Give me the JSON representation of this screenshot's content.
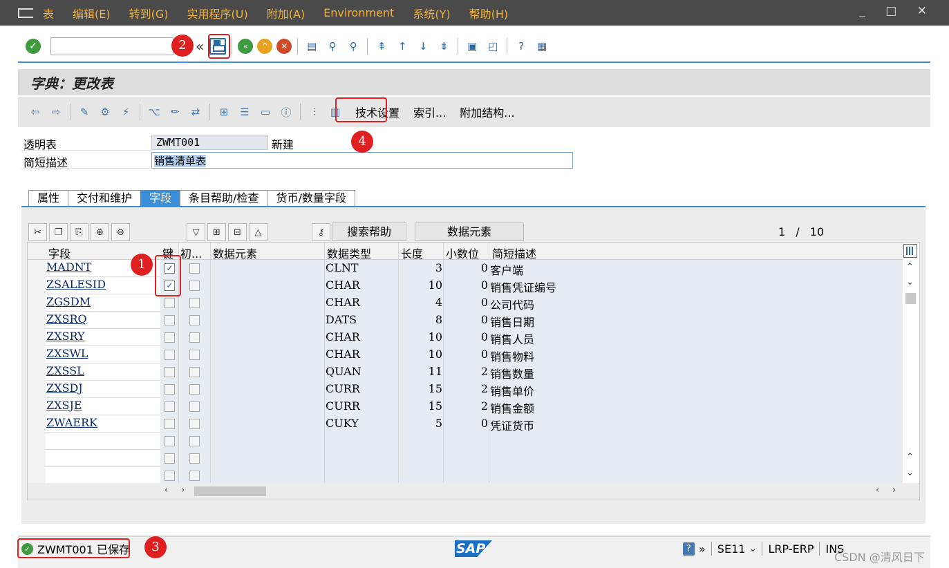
{
  "menubar": {
    "items": [
      "表",
      "编辑(E)",
      "转到(G)",
      "实用程序(U)",
      "附加(A)",
      "Environment",
      "系统(Y)",
      "帮助(H)"
    ],
    "window_controls": "_ □ ✕"
  },
  "toolbar": {
    "command_value": "",
    "collapse_glyph": "«"
  },
  "title": "字典：更改表",
  "app_toolbar": {
    "tech_settings": "技术设置",
    "indexes": "索引...",
    "append_structures": "附加结构..."
  },
  "header": {
    "table_label": "透明表",
    "table_name": "ZWMT001",
    "table_status": "新建",
    "desc_label": "简短描述",
    "desc_value": "销售清单表"
  },
  "tabs": [
    {
      "label": "属性",
      "active": false
    },
    {
      "label": "交付和维护",
      "active": false
    },
    {
      "label": "字段",
      "active": true
    },
    {
      "label": "条目帮助/检查",
      "active": false
    },
    {
      "label": "货币/数量字段",
      "active": false
    }
  ],
  "grid_toolbar": {
    "search_help": "搜索帮助",
    "data_element": "数据元素",
    "page_current": "1",
    "page_sep": "/",
    "page_total": "10"
  },
  "columns": {
    "field": "字段",
    "key": "键",
    "initial": "初...",
    "data_element": "数据元素",
    "data_type": "数据类型",
    "length": "长度",
    "decimals": "小数位",
    "short_desc": "简短描述"
  },
  "rows": [
    {
      "field": "MADNT",
      "key": true,
      "initial": false,
      "dtel": "",
      "type": "CLNT",
      "len": "3",
      "dec": "0",
      "desc": "客户端"
    },
    {
      "field": "ZSALESID",
      "key": true,
      "initial": false,
      "dtel": "",
      "type": "CHAR",
      "len": "10",
      "dec": "0",
      "desc": "销售凭证编号"
    },
    {
      "field": "ZGSDM",
      "key": false,
      "initial": false,
      "dtel": "",
      "type": "CHAR",
      "len": "4",
      "dec": "0",
      "desc": "公司代码"
    },
    {
      "field": "ZXSRQ",
      "key": false,
      "initial": false,
      "dtel": "",
      "type": "DATS",
      "len": "8",
      "dec": "0",
      "desc": "销售日期"
    },
    {
      "field": "ZXSRY",
      "key": false,
      "initial": false,
      "dtel": "",
      "type": "CHAR",
      "len": "10",
      "dec": "0",
      "desc": "销售人员"
    },
    {
      "field": "ZXSWL",
      "key": false,
      "initial": false,
      "dtel": "",
      "type": "CHAR",
      "len": "10",
      "dec": "0",
      "desc": "销售物料"
    },
    {
      "field": "ZXSSL",
      "key": false,
      "initial": false,
      "dtel": "",
      "type": "QUAN",
      "len": "11",
      "dec": "2",
      "desc": "销售数量"
    },
    {
      "field": "ZXSDJ",
      "key": false,
      "initial": false,
      "dtel": "",
      "type": "CURR",
      "len": "15",
      "dec": "2",
      "desc": "销售单价"
    },
    {
      "field": "ZXSJE",
      "key": false,
      "initial": false,
      "dtel": "",
      "type": "CURR",
      "len": "15",
      "dec": "2",
      "desc": "销售金额"
    },
    {
      "field": "ZWAERK",
      "key": false,
      "initial": false,
      "dtel": "",
      "type": "CUKY",
      "len": "5",
      "dec": "0",
      "desc": "凭证货币"
    },
    {
      "field": "",
      "key": false,
      "initial": false,
      "dtel": "",
      "type": "",
      "len": "",
      "dec": "",
      "desc": ""
    },
    {
      "field": "",
      "key": false,
      "initial": false,
      "dtel": "",
      "type": "",
      "len": "",
      "dec": "",
      "desc": ""
    },
    {
      "field": "",
      "key": false,
      "initial": false,
      "dtel": "",
      "type": "",
      "len": "",
      "dec": "",
      "desc": ""
    }
  ],
  "status": {
    "message": "ZWMT001 已保存",
    "sap_logo": "SAP",
    "transaction": "SE11",
    "system": "LRP-ERP",
    "mode": "INS",
    "help_glyph": "?"
  },
  "annotations": [
    "1",
    "2",
    "3",
    "4"
  ],
  "watermark": "CSDN @清风日下",
  "colors": {
    "accent": "#3a8fd8",
    "menu_text": "#f0b03c",
    "annotation": "#e02020",
    "ok_green": "#3f9b3f"
  }
}
